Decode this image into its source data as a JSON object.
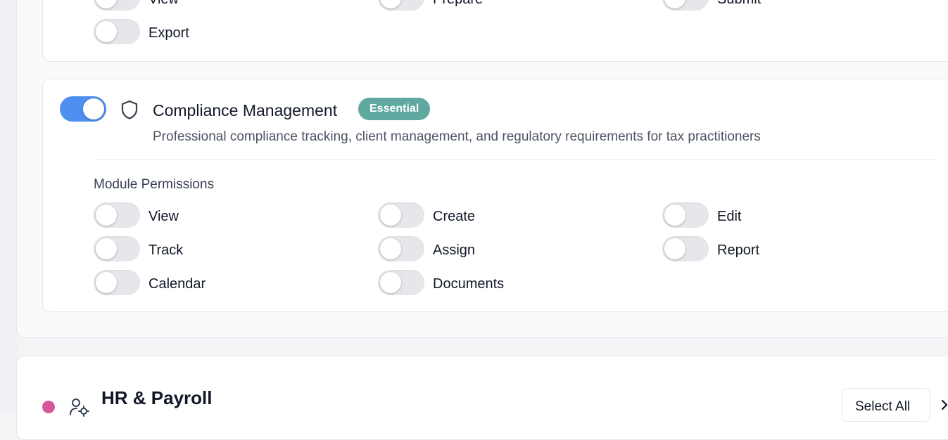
{
  "previous_module": {
    "permissions": [
      {
        "label": "View",
        "enabled": false
      },
      {
        "label": "Prepare",
        "enabled": false
      },
      {
        "label": "Submit",
        "enabled": false
      },
      {
        "label": "Export",
        "enabled": false
      }
    ]
  },
  "compliance_module": {
    "enabled": true,
    "icon": "shield-icon",
    "title": "Compliance Management",
    "badge": "Essential",
    "badge_color": "#5fa8a0",
    "description": "Professional compliance tracking, client management, and regulatory requirements for tax practitioners",
    "permissions_heading": "Module Permissions",
    "permissions": [
      {
        "label": "View",
        "enabled": false
      },
      {
        "label": "Create",
        "enabled": false
      },
      {
        "label": "Edit",
        "enabled": false
      },
      {
        "label": "Track",
        "enabled": false
      },
      {
        "label": "Assign",
        "enabled": false
      },
      {
        "label": "Report",
        "enabled": false
      },
      {
        "label": "Calendar",
        "enabled": false
      },
      {
        "label": "Documents",
        "enabled": false
      }
    ]
  },
  "hr_section": {
    "dot_color": "#d6569a",
    "icon": "user-gear-icon",
    "title": "HR & Payroll",
    "select_all_label": "Select All"
  },
  "colors": {
    "toggle_on": "#4f8ff0",
    "toggle_off": "#e5e7eb"
  }
}
